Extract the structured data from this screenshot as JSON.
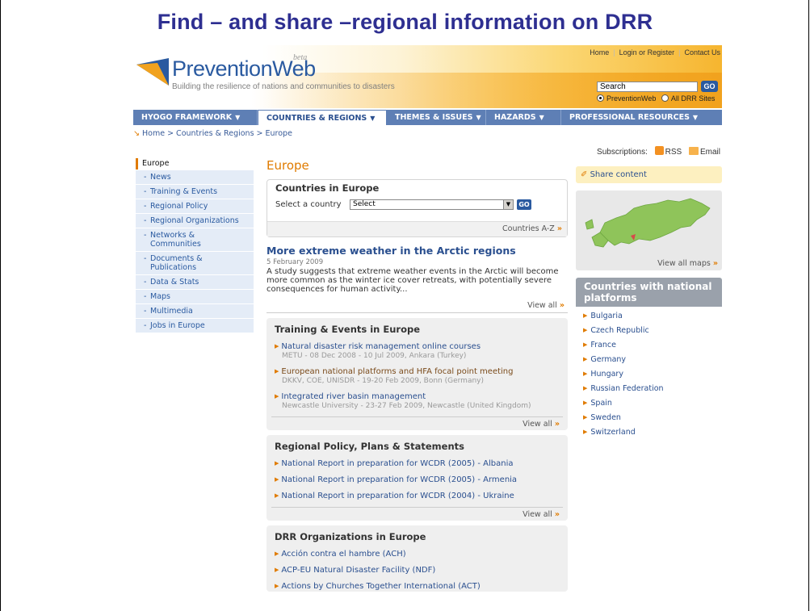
{
  "slide": {
    "title": "Find – and share –regional information on DRR"
  },
  "header": {
    "logo_text_a": "Prevention",
    "logo_text_b": "Web",
    "logo_beta": "beta",
    "tagline": "Building the resilience of nations and communities to disasters",
    "top_links": [
      "Home",
      "Login or Register",
      "Contact Us"
    ],
    "search_value": "Search",
    "search_go": "GO",
    "search_opt_1": "PreventionWeb",
    "search_opt_2": "All DRR Sites"
  },
  "nav": {
    "items": [
      {
        "label": "HYOGO FRAMEWORK"
      },
      {
        "label": "COUNTRIES & REGIONS"
      },
      {
        "label": "THEMES & ISSUES"
      },
      {
        "label": "HAZARDS"
      },
      {
        "label": "PROFESSIONAL RESOURCES"
      }
    ],
    "active_index": 1
  },
  "breadcrumb": "Home > Countries & Regions > Europe",
  "subscriptions": {
    "label": "Subscriptions:",
    "rss": "RSS",
    "email": "Email"
  },
  "sidebar": {
    "head": "Europe",
    "items": [
      "News",
      "Training & Events",
      "Regional Policy",
      "Regional Organizations",
      "Networks & Communities",
      "Documents & Publications",
      "Data & Stats",
      "Maps",
      "Multimedia",
      "Jobs in Europe"
    ]
  },
  "main": {
    "page_title": "Europe",
    "countries_box": {
      "heading": "Countries in Europe",
      "label": "Select a country",
      "select_value": "Select",
      "go": "GO",
      "footer": "Countries A-Z"
    },
    "news": {
      "title": "More extreme weather in the Arctic regions",
      "date": "5 February 2009",
      "body": "A study suggests that extreme weather events in the Arctic will become more common as the winter ice cover retreats, with potentially severe consequences for human activity...",
      "view_all": "View all"
    },
    "training": {
      "heading": "Training & Events in Europe",
      "items": [
        {
          "title": "Natural disaster risk management online courses",
          "sub": "METU - 08 Dec 2008 - 10 Jul 2009, Ankara (Turkey)"
        },
        {
          "title": "European national platforms and HFA focal point meeting",
          "sub": "DKKV, COE, UNISDR - 19-20 Feb 2009, Bonn (Germany)"
        },
        {
          "title": "Integrated river basin management",
          "sub": "Newcastle University - 23-27 Feb 2009, Newcastle (United Kingdom)"
        }
      ],
      "view_all": "View all"
    },
    "policy": {
      "heading": "Regional Policy, Plans & Statements",
      "items": [
        "National Report in preparation for WCDR (2005) - Albania",
        "National Report in preparation for WCDR (2005) - Armenia",
        "National Report in preparation for WCDR (2004) - Ukraine"
      ],
      "view_all": "View all"
    },
    "orgs": {
      "heading": "DRR Organizations in Europe",
      "items": [
        "Acción contra el hambre (ACH)",
        "ACP-EU Natural Disaster Facility (NDF)",
        "Actions by Churches Together International (ACT)"
      ]
    }
  },
  "right": {
    "share": "Share content",
    "view_maps": "View all maps",
    "national_head": "Countries with national platforms",
    "countries": [
      "Bulgaria",
      "Czech Republic",
      "France",
      "Germany",
      "Hungary",
      "Russian Federation",
      "Spain",
      "Sweden",
      "Switzerland"
    ]
  },
  "colors": {
    "accent_orange": "#e07b00",
    "nav_blue": "#5e7fb5",
    "link_blue": "#2a4f8f",
    "title_navy": "#2e2f91"
  }
}
